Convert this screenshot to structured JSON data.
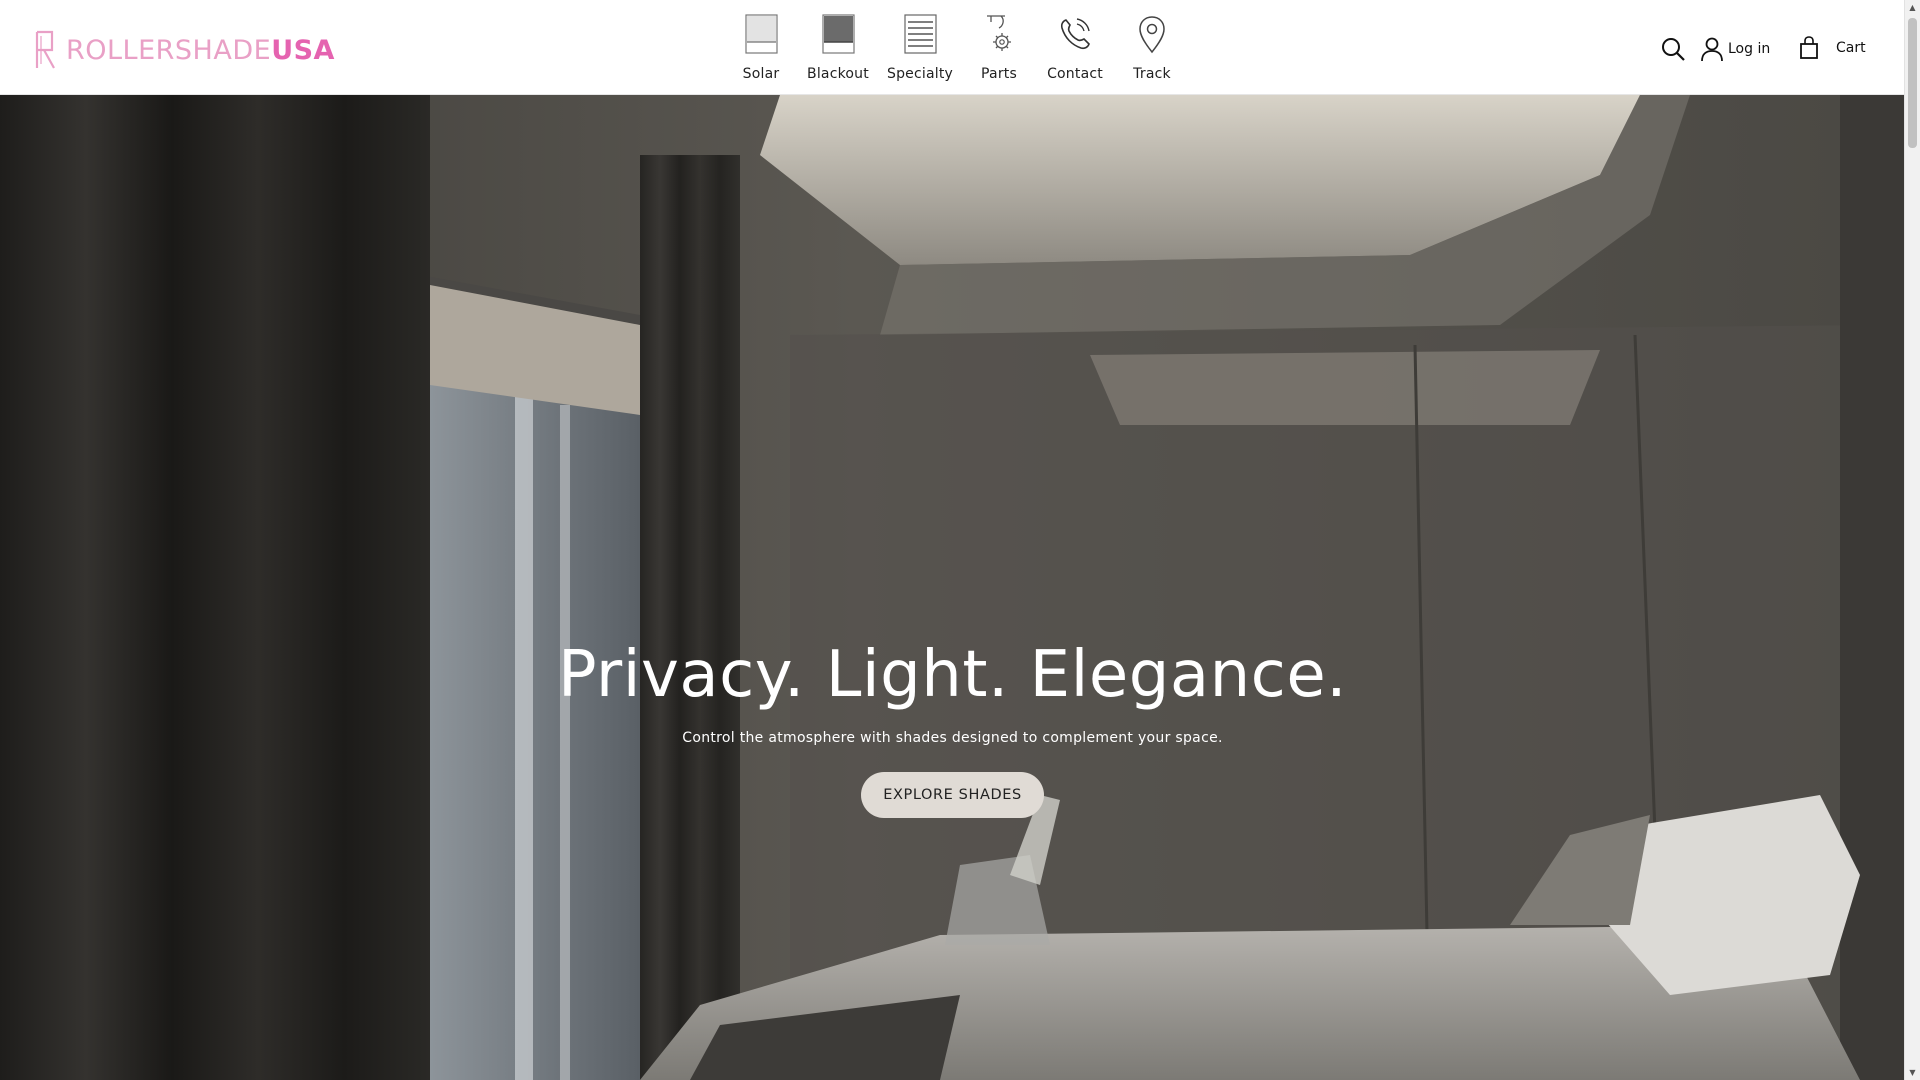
{
  "brand": {
    "logo_text_light": "ROLLERSHADE",
    "logo_text_bold": "USA",
    "logo_icon": "r-monogram-icon",
    "color_light": "#e9a0c6",
    "color_bold": "#e563b0"
  },
  "nav": {
    "items": [
      {
        "label": "Solar",
        "icon": "solar-shade-icon"
      },
      {
        "label": "Blackout",
        "icon": "blackout-shade-icon"
      },
      {
        "label": "Specialty",
        "icon": "specialty-shade-icon"
      },
      {
        "label": "Parts",
        "icon": "parts-gear-icon"
      },
      {
        "label": "Contact",
        "icon": "phone-icon"
      },
      {
        "label": "Track",
        "icon": "map-pin-icon"
      }
    ]
  },
  "header_tools": {
    "search_icon": "search-icon",
    "login_label": "Log in",
    "login_icon": "user-icon",
    "cart_label": "Cart",
    "cart_icon": "shopping-bag-icon"
  },
  "hero": {
    "title": "Privacy. Light. Elegance.",
    "subtitle": "Control the atmosphere with shades designed to complement your space.",
    "cta_label": "EXPLORE SHADES",
    "cta_color": "#e0dbd5"
  }
}
